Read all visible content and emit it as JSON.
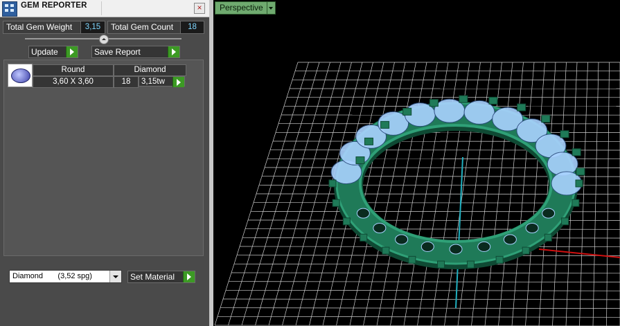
{
  "titlebar": {
    "title": "GEM REPORTER",
    "close_glyph": "×"
  },
  "summary": {
    "weight_label": "Total Gem Weight",
    "weight_value": "3,15",
    "count_label": "Total Gem Count",
    "count_value": "18"
  },
  "actions": {
    "update_label": "Update",
    "save_report_label": "Save Report"
  },
  "gem_table": {
    "headers": [
      "Round",
      "Diamond"
    ],
    "row": {
      "size": "3,60 X 3,60",
      "count": "18",
      "weight": "3,15tw"
    }
  },
  "material": {
    "selected": "Diamond       (3,52 spg)",
    "set_label": "Set Material"
  },
  "viewport": {
    "view_name": "Perspective"
  },
  "colors": {
    "panel_bg": "#4a4a4a",
    "value_text": "#7fd7ff",
    "play_green": "#3c9a24",
    "ring_green": "#1f7a58",
    "gem_blue": "#a9d2ff",
    "grid_line": "#d0d0d0",
    "axis_cyan": "#20b0c0",
    "axis_red": "#d01010"
  },
  "icons": [
    "app-icon",
    "close-icon",
    "slider-knob-icon",
    "play-arrow-icon",
    "dropdown-arrow-icon",
    "gem-oval-icon"
  ]
}
